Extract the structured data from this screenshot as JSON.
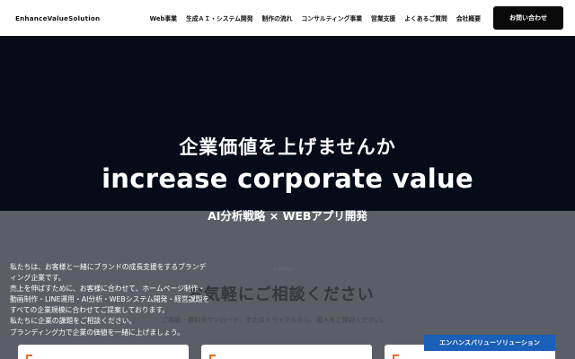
{
  "header": {
    "logo": "EnhanceValueSolution",
    "nav": [
      {
        "label": "Web事業",
        "name": "nav-web-business"
      },
      {
        "label": "生成ＡＩ・システム開発",
        "name": "nav-ai-system"
      },
      {
        "label": "制作の流れ",
        "name": "nav-workflow"
      },
      {
        "label": "コンサルティング事業",
        "name": "nav-consulting"
      },
      {
        "label": "営業支援",
        "name": "nav-sales-support"
      },
      {
        "label": "よくあるご質問",
        "name": "nav-faq"
      },
      {
        "label": "会社概要",
        "name": "nav-company"
      }
    ],
    "contact_label": "お問い合わせ"
  },
  "hero": {
    "title": "企業価値を上げませんか",
    "subtitle_en": "increase corporate value",
    "tagline": "AI分析戦略 × WEBアプリ開発"
  },
  "intro": {
    "lines": [
      "私たちは、お客様と一緒にブランドの成長支援をするブランデ",
      "ィング企業です。",
      "売上を伸ばすために、お客様に合わせて、ホームページ制作・",
      "動画制作・LINE運用・AI分析・WEBシステム開発・経営課題を",
      "すべての企業規模に合わせてご提案しております。",
      "私たちに企業の課題をご相談ください。",
      "ブランディング力で企業の価値を一緒に上げましょう。"
    ]
  },
  "behind": {
    "small_label": "CONTACT",
    "heading": "お気軽にご相談ください",
    "description": "ご相談・資料ダウンロード、またはトライアルから、導入をご検討ください。"
  },
  "floating_badge": "エンハンスバリューソリューション",
  "colors": {
    "hero_bg": "#060b19",
    "overlay_bg": "#5b5e66",
    "contact_button": "#0a0a0a",
    "badge": "#1a5fb8",
    "accent": "#e8692a"
  }
}
